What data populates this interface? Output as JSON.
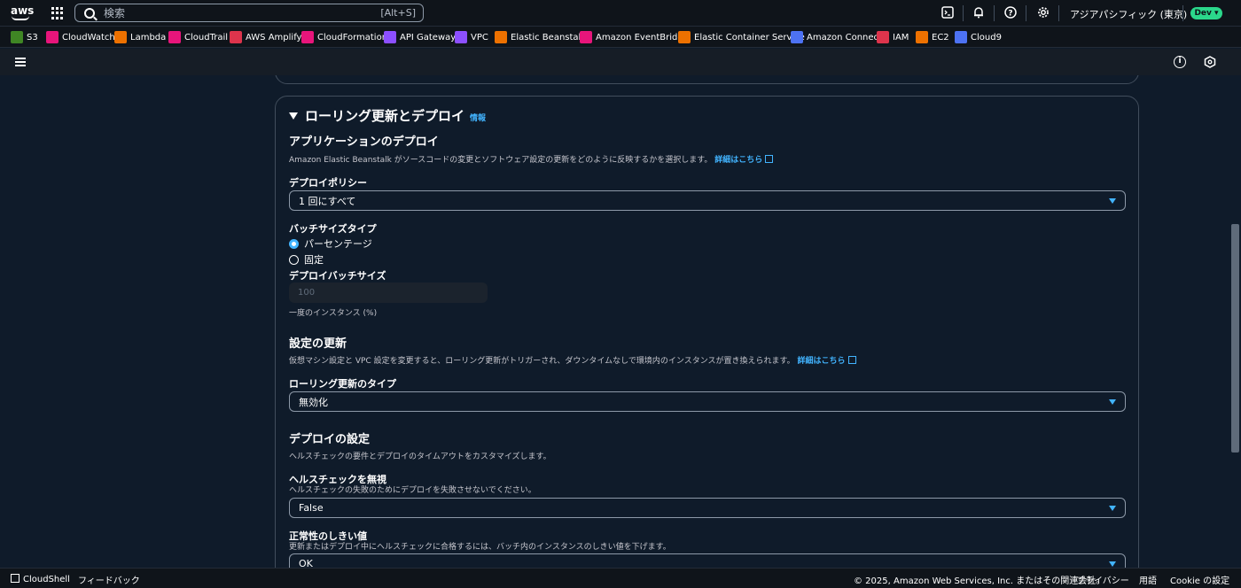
{
  "topnav": {
    "logo_text": "aws",
    "search_placeholder": "検索",
    "search_shortcut": "[Alt+S]",
    "region": "アジアパシフィック (東京) ▾",
    "account_badge": "Dev ▾"
  },
  "favorites": [
    {
      "label": "S3",
      "color": "#3f8624"
    },
    {
      "label": "CloudWatch",
      "color": "#e7157b"
    },
    {
      "label": "Lambda",
      "color": "#ed7100"
    },
    {
      "label": "CloudTrail",
      "color": "#e7157b"
    },
    {
      "label": "AWS Amplify",
      "color": "#dd344c"
    },
    {
      "label": "CloudFormation",
      "color": "#e7157b"
    },
    {
      "label": "API Gateway",
      "color": "#8c4fff"
    },
    {
      "label": "VPC",
      "color": "#8c4fff"
    },
    {
      "label": "Elastic Beanstalk",
      "color": "#ed7100"
    },
    {
      "label": "Amazon EventBridge",
      "color": "#e7157b"
    },
    {
      "label": "Elastic Container Service",
      "color": "#ed7100"
    },
    {
      "label": "Amazon Connect",
      "color": "#4d72f3"
    },
    {
      "label": "IAM",
      "color": "#dd344c"
    },
    {
      "label": "EC2",
      "color": "#ed7100"
    },
    {
      "label": "Cloud9",
      "color": "#4d72f3"
    }
  ],
  "section": {
    "title": "ローリング更新とデプロイ",
    "info": "情報",
    "app_deploy": {
      "heading": "アプリケーションのデプロイ",
      "description": "Amazon Elastic Beanstalk がソースコードの変更とソフトウェア設定の更新をどのように反映するかを選択します。",
      "link": "詳細はこちら",
      "policy_label": "デプロイポリシー",
      "policy_value": "1 回にすべて",
      "batch_type_label": "バッチサイズタイプ",
      "radio_percent": "パーセンテージ",
      "radio_fixed": "固定",
      "batch_size_label": "デプロイバッチサイズ",
      "batch_size_value": "100",
      "batch_size_hint": "一度のインスタンス (%)"
    },
    "config_update": {
      "heading": "設定の更新",
      "description": "仮想マシン設定と VPC 設定を変更すると、ローリング更新がトリガーされ、ダウンタイムなしで環境内のインスタンスが置き換えられます。",
      "link": "詳細はこちら",
      "type_label": "ローリング更新のタイプ",
      "type_value": "無効化"
    },
    "deploy_settings": {
      "heading": "デプロイの設定",
      "description": "ヘルスチェックの要件とデプロイのタイムアウトをカスタマイズします。",
      "ignore_label": "ヘルスチェックを無視",
      "ignore_desc": "ヘルスチェックの失敗のためにデプロイを失敗させないでください。",
      "ignore_value": "False",
      "threshold_label": "正常性のしきい値",
      "threshold_desc": "更新またはデプロイ中にヘルスチェックに合格するには、バッチ内のインスタンスのしきい値を下げます。",
      "threshold_value": "OK"
    }
  },
  "footer": {
    "cloudshell": "CloudShell",
    "feedback": "フィードバック",
    "copyright": "© 2025, Amazon Web Services, Inc. またはその関連会社。",
    "privacy": "プライバシー",
    "terms": "用語",
    "cookie": "Cookie の設定"
  }
}
